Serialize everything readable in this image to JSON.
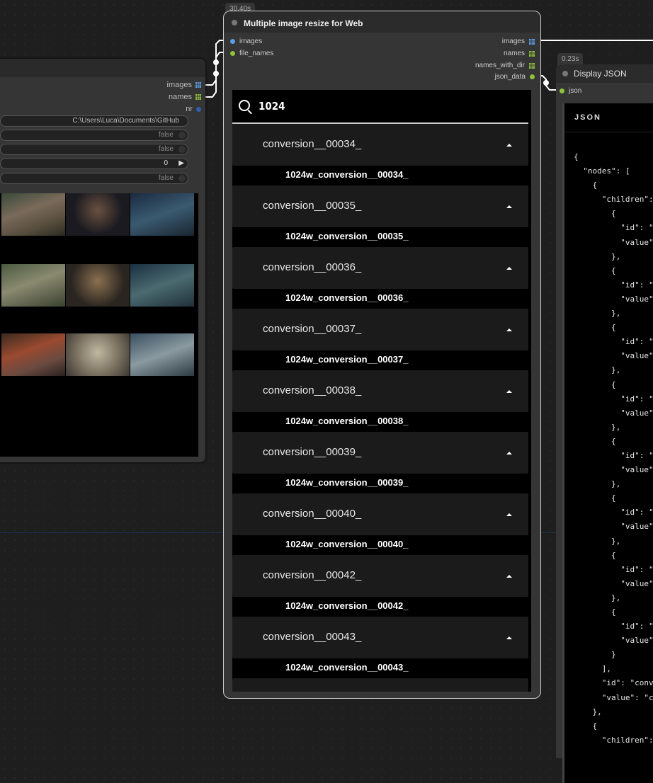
{
  "left_node": {
    "outputs": [
      {
        "label": "images",
        "color": "#5aa0e8"
      },
      {
        "label": "names",
        "color": "#8fc23a"
      },
      {
        "label": "nr",
        "color": "#2f5fa8"
      }
    ],
    "widgets": {
      "path_value": "C:\\Users\\Luca\\Documents\\GitHub",
      "bool1": "false",
      "bool2": "false",
      "number": "0",
      "bool3": "false"
    }
  },
  "main_node": {
    "timing": "30.40s",
    "title": "Multiple image resize for Web",
    "inputs": [
      {
        "label": "images",
        "color": "#5aa0e8"
      },
      {
        "label": "file_names",
        "color": "#8fc23a"
      }
    ],
    "outputs": [
      {
        "label": "images",
        "color": "#5aa0e8"
      },
      {
        "label": "names",
        "color": "#8fc23a"
      },
      {
        "label": "names_with_dir",
        "color": "#8fc23a"
      },
      {
        "label": "json_data",
        "color": "#8fc23a"
      }
    ],
    "search_query": "1024",
    "items": [
      {
        "label": "conversion__00034_",
        "child": "1024w_conversion__00034_"
      },
      {
        "label": "conversion__00035_",
        "child": "1024w_conversion__00035_"
      },
      {
        "label": "conversion__00036_",
        "child": "1024w_conversion__00036_"
      },
      {
        "label": "conversion__00037_",
        "child": "1024w_conversion__00037_"
      },
      {
        "label": "conversion__00038_",
        "child": "1024w_conversion__00038_"
      },
      {
        "label": "conversion__00039_",
        "child": "1024w_conversion__00039_"
      },
      {
        "label": "conversion__00040_",
        "child": "1024w_conversion__00040_"
      },
      {
        "label": "conversion__00042_",
        "child": "1024w_conversion__00042_"
      },
      {
        "label": "conversion__00043_",
        "child": "1024w_conversion__00043_"
      }
    ]
  },
  "json_node": {
    "timing": "0.23s",
    "title": "Display JSON",
    "input_label": "json",
    "header": "JSON",
    "code_lines": [
      "{",
      "  \"nodes\": [",
      "    {",
      "      \"children\":",
      "        {",
      "          \"id\": \"",
      "          \"value\"",
      "        },",
      "        {",
      "          \"id\": \"",
      "          \"value\"",
      "        },",
      "        {",
      "          \"id\": \"",
      "          \"value\"",
      "        },",
      "        {",
      "          \"id\": \"",
      "          \"value\"",
      "        },",
      "        {",
      "          \"id\": \"",
      "          \"value\"",
      "        },",
      "        {",
      "          \"id\": \"",
      "          \"value\"",
      "        },",
      "        {",
      "          \"id\": \"",
      "          \"value\"",
      "        },",
      "        {",
      "          \"id\": \"",
      "          \"value\"",
      "        }",
      "      ],",
      "      \"id\": \"conv",
      "      \"value\": \"c",
      "    },",
      "    {",
      "      \"children\":"
    ]
  },
  "colors": {
    "link": "#ffffff",
    "accent_blue": "#5aa0e8",
    "accent_green": "#8fc23a"
  }
}
